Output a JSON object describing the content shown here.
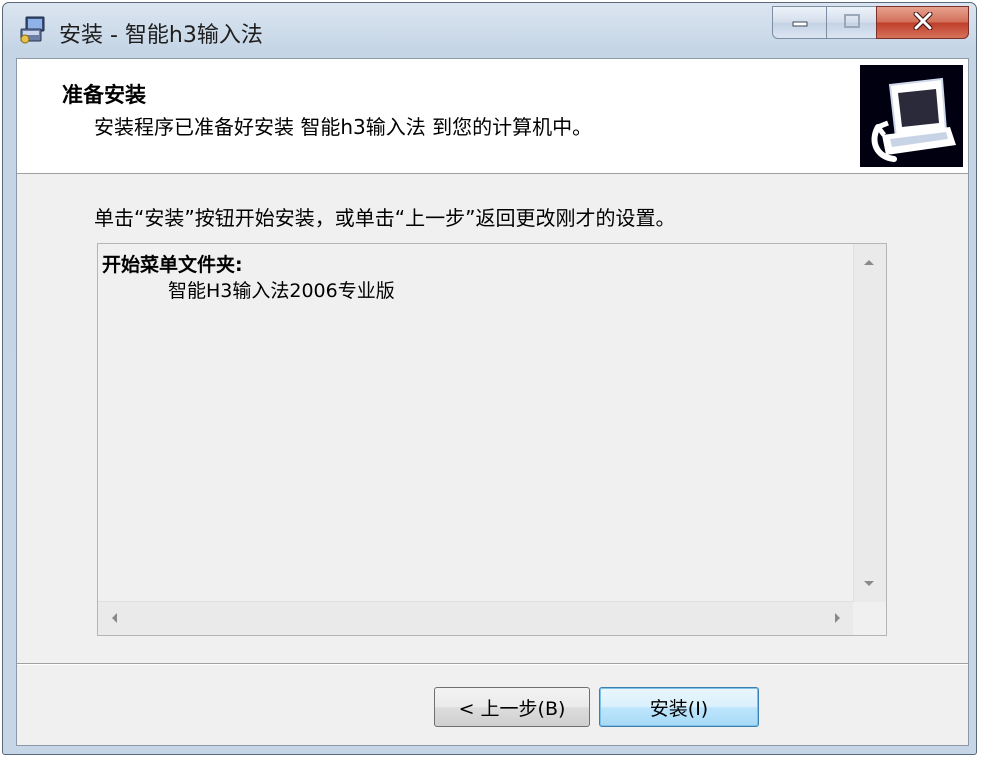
{
  "window": {
    "title": "安装 - 智能h3输入法",
    "title_icon": "setup-icon",
    "controls": {
      "minimize_icon": "minimize-icon",
      "maximize_icon": "maximize-icon",
      "close_icon": "close-icon"
    }
  },
  "header": {
    "title": "准备安装",
    "subtitle": "安装程序已准备好安装 智能h3输入法 到您的计算机中。",
    "image_icon": "computer-install-icon"
  },
  "main": {
    "instruction": "单击“安装”按钮开始安装，或单击“上一步”返回更改刚才的设置。",
    "memo": {
      "label": "开始菜单文件夹:",
      "value": "智能H3输入法2006专业版"
    }
  },
  "buttons": {
    "back_label": "< 上一步(B)",
    "install_label": "安装(I)"
  },
  "colors": {
    "frame": "#c5d5e6",
    "client_bg": "#f0f0f0",
    "close_button": "#c94a33",
    "default_button_border": "#3c7fb1"
  }
}
